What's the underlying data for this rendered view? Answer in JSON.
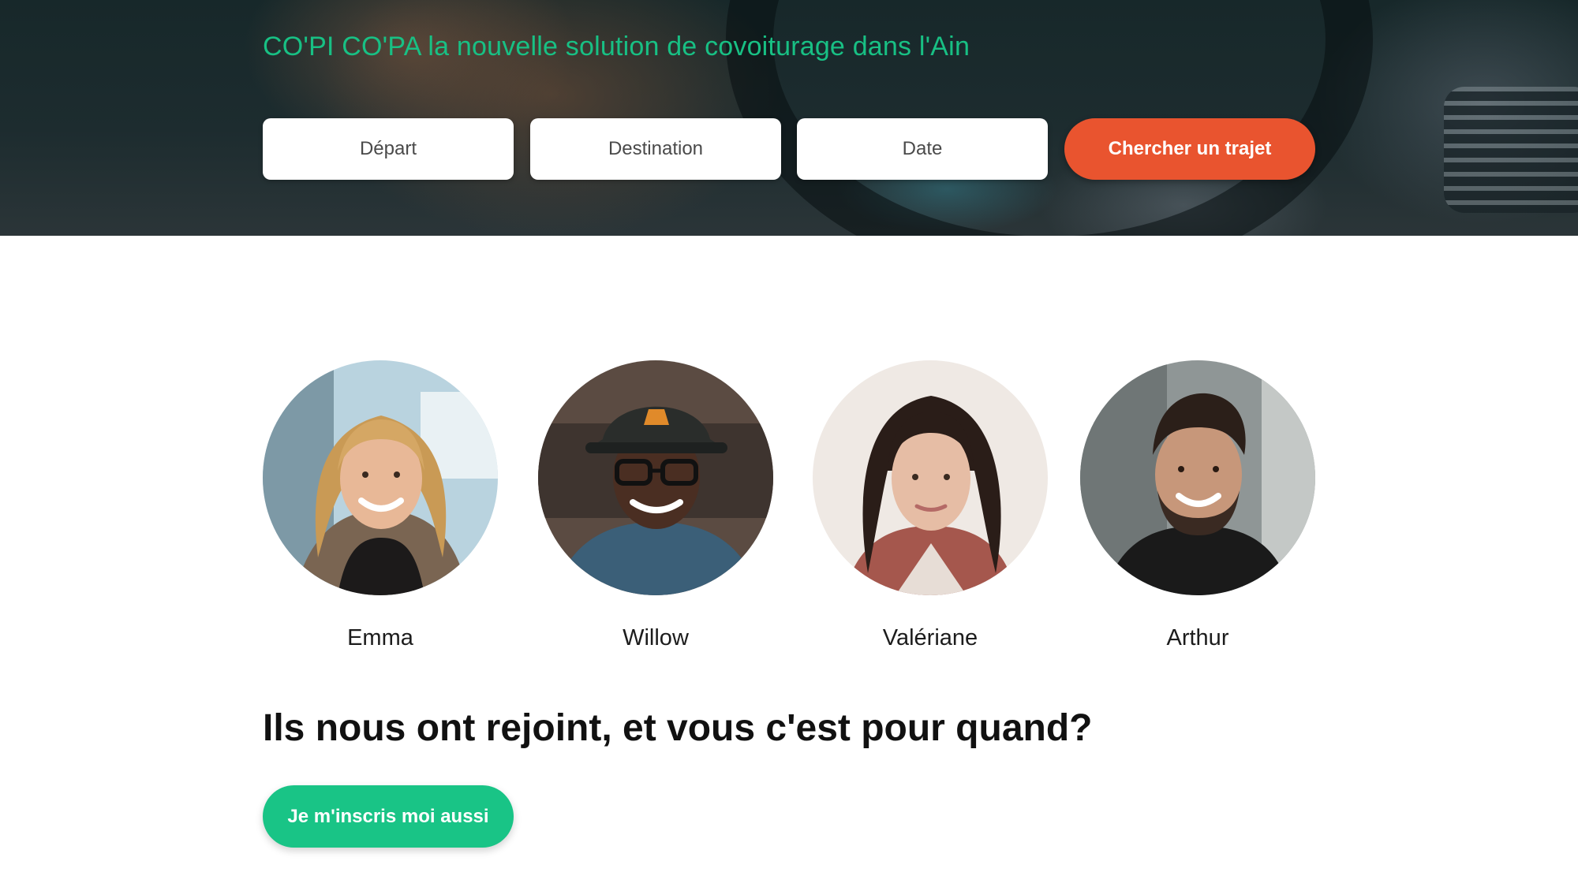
{
  "hero": {
    "tagline": "CO'PI CO'PA la nouvelle solution de covoiturage dans l'Ain",
    "search": {
      "depart_placeholder": "Départ",
      "destination_placeholder": "Destination",
      "date_placeholder": "Date",
      "submit_label": "Chercher un trajet"
    }
  },
  "members": [
    {
      "name": "Emma"
    },
    {
      "name": "Willow"
    },
    {
      "name": "Valériane"
    },
    {
      "name": "Arthur"
    }
  ],
  "cta": {
    "heading": "Ils nous ont rejoint, et vous c'est pour quand?",
    "button_label": "Je m'inscris moi aussi"
  },
  "colors": {
    "brand_green": "#19c486",
    "accent_orange": "#e9542f",
    "text_dark": "#111111"
  }
}
